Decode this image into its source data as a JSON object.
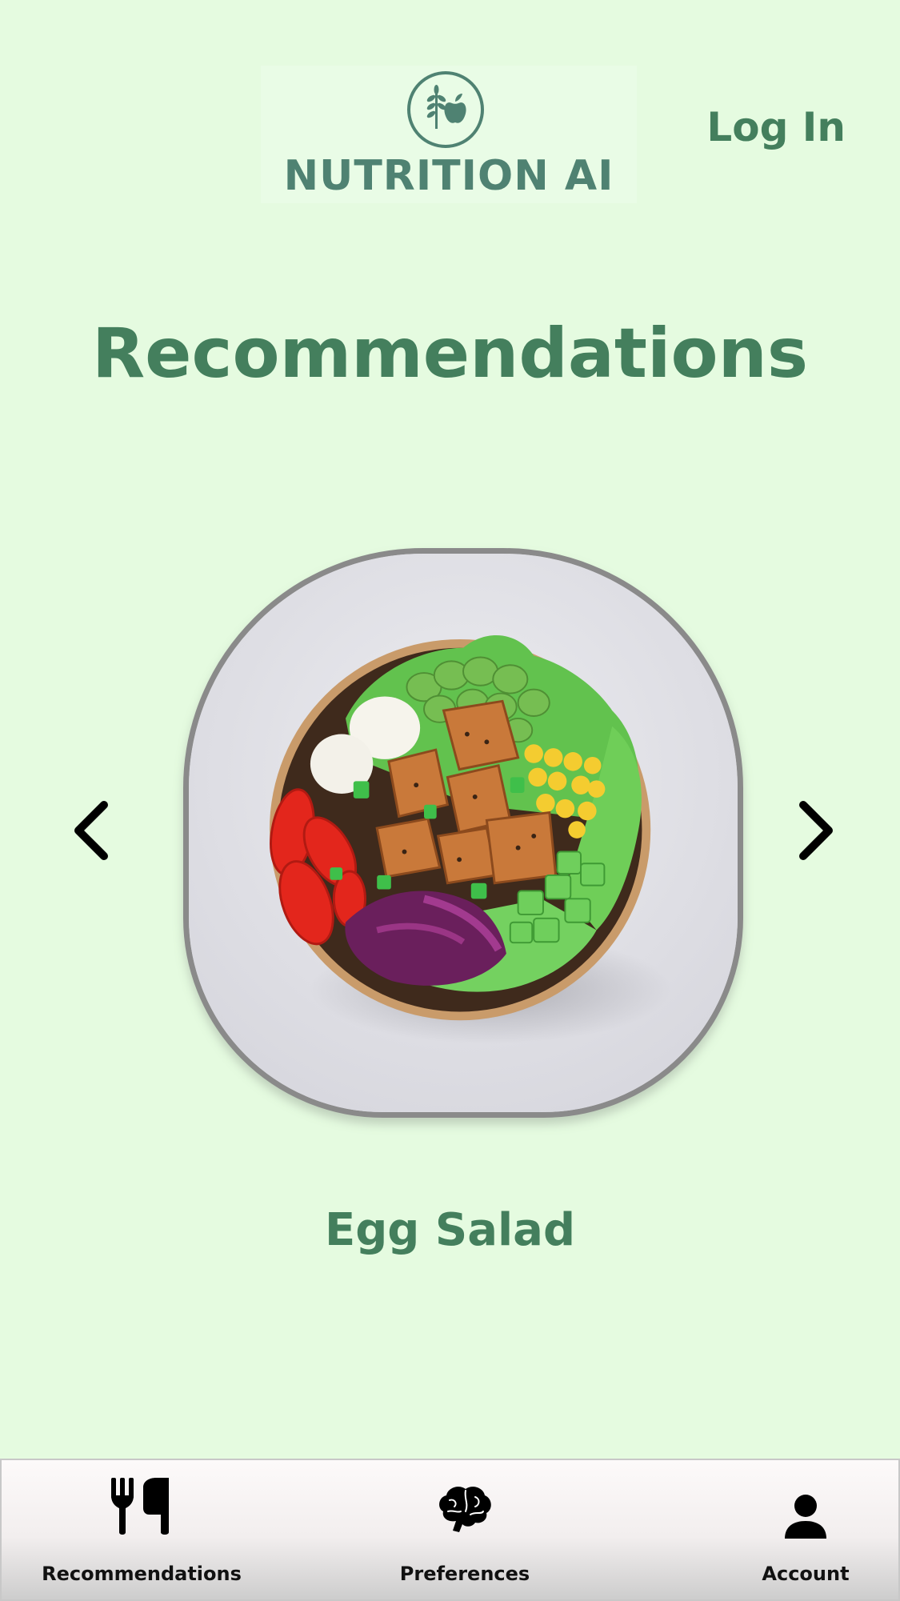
{
  "header": {
    "logo_text": "NUTRITION AI",
    "login_label": "Log In"
  },
  "main": {
    "title": "Recommendations",
    "carousel": {
      "current_item": "Egg Salad",
      "prev_icon": "chevron-left-icon",
      "next_icon": "chevron-right-icon"
    }
  },
  "bottom_nav": {
    "items": [
      {
        "label": "Recommendations",
        "icon": "fork-knife-icon"
      },
      {
        "label": "Preferences",
        "icon": "brain-icon"
      },
      {
        "label": "Account",
        "icon": "person-icon"
      }
    ]
  },
  "colors": {
    "background": "#e5fbe0",
    "accent_green": "#447f5d",
    "logo_teal": "#4f8272"
  }
}
